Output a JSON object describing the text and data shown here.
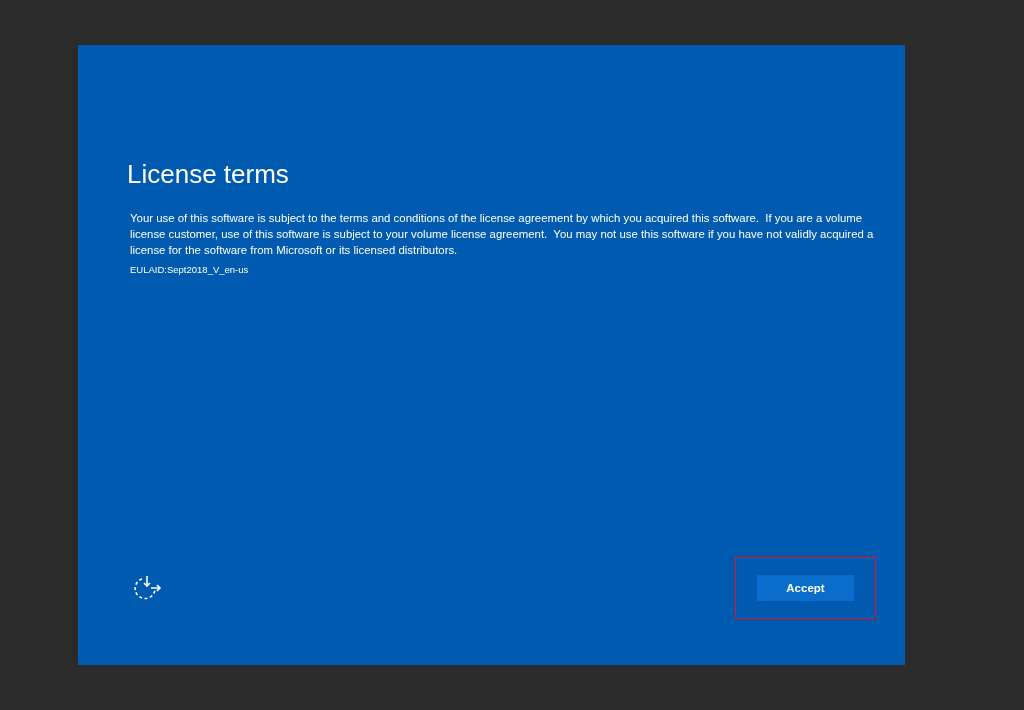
{
  "title": "License terms",
  "body": "Your use of this software is subject to the terms and conditions of the license agreement by which you acquired this software.  If you are a volume license customer, use of this software is subject to your volume license agreement.  You may not use this software if you have not validly acquired a license for the software from Microsoft or its licensed distributors.",
  "eula_id": "EULAID:Sept2018_V_en-us",
  "accept_button": {
    "label": "Accept",
    "highlighted": true
  }
}
